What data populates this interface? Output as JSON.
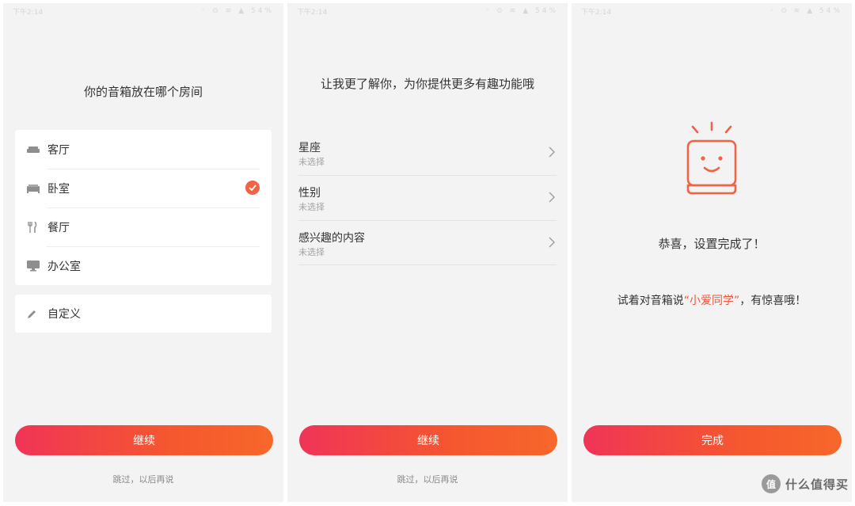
{
  "status": {
    "time": "下午2:14",
    "icons": "◦ ⊙ ≋ ▲ 54%"
  },
  "screen1": {
    "title": "你的音箱放在哪个房间",
    "rooms": [
      {
        "label": "客厅",
        "icon": "sofa-icon",
        "selected": false
      },
      {
        "label": "卧室",
        "icon": "bed-icon",
        "selected": true
      },
      {
        "label": "餐厅",
        "icon": "fork-knife-icon",
        "selected": false
      },
      {
        "label": "办公室",
        "icon": "monitor-icon",
        "selected": false
      }
    ],
    "custom_label": "自定义",
    "continue_label": "继续",
    "skip_label": "跳过，以后再说"
  },
  "screen2": {
    "title": "让我更了解你，为你提供更多有趣功能哦",
    "items": [
      {
        "label": "星座",
        "value": "未选择"
      },
      {
        "label": "性别",
        "value": "未选择"
      },
      {
        "label": "感兴趣的内容",
        "value": "未选择"
      }
    ],
    "continue_label": "继续",
    "skip_label": "跳过，以后再说"
  },
  "screen3": {
    "congrats": "恭喜，设置完成了！",
    "try_prefix": "试着对音箱说",
    "try_highlight": "“小爱同学”",
    "try_suffix": "，有惊喜哦！",
    "done_label": "完成"
  },
  "watermark": {
    "badge": "值",
    "text": "什么值得买"
  },
  "colors": {
    "accent": "#f2573b",
    "gradient_start": "#f03457",
    "gradient_end": "#f7672a",
    "check": "#f26245"
  }
}
